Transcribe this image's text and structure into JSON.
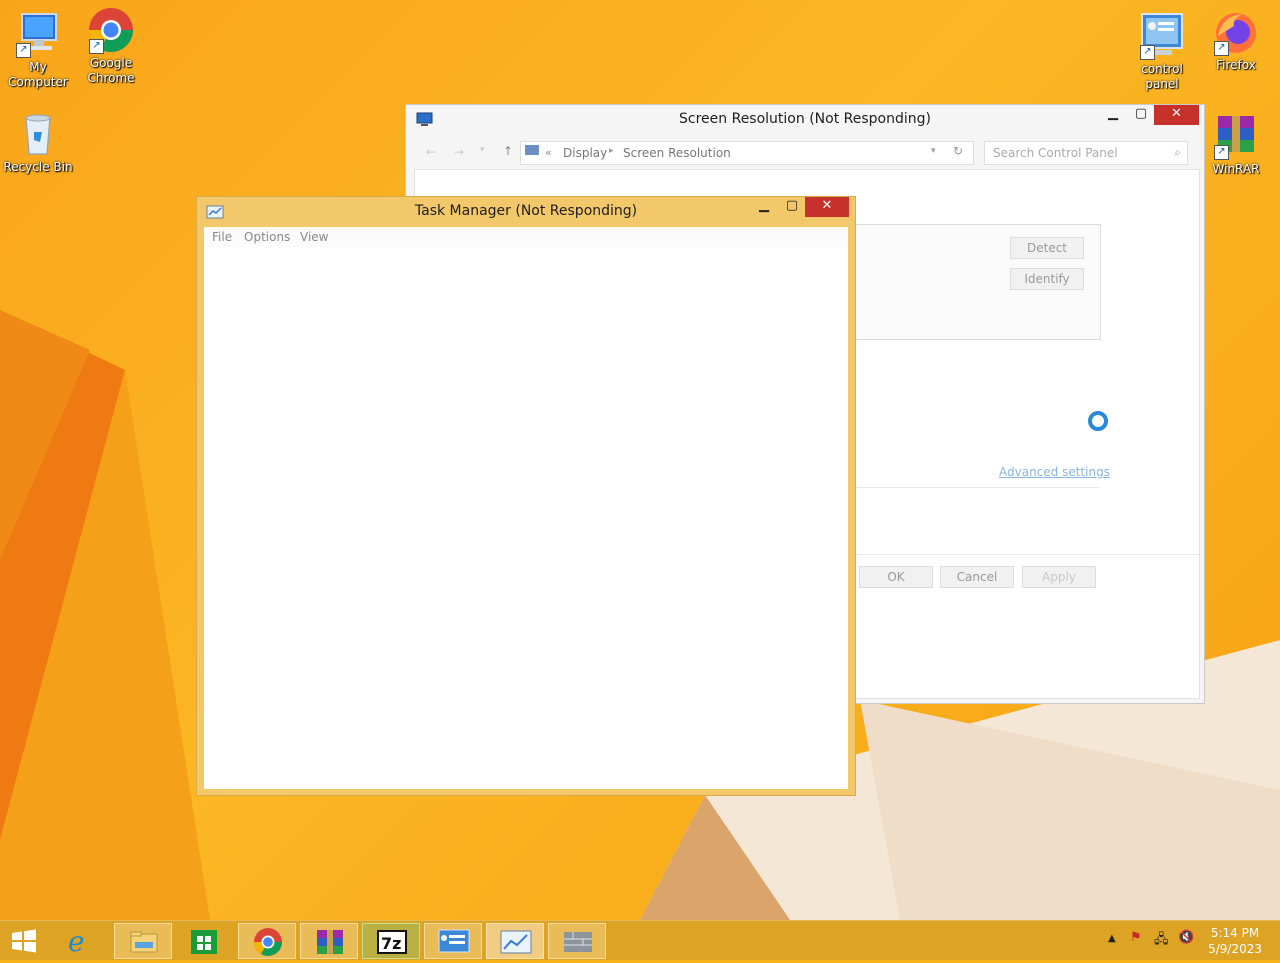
{
  "desktop_icons": {
    "my_computer": "My Computer",
    "chrome": "Google Chrome",
    "recycle_bin": "Recycle Bin",
    "control_panel": "control panel",
    "firefox": "Firefox",
    "winrar": "WinRAR"
  },
  "screen_res_window": {
    "title": "Screen Resolution (Not Responding)",
    "breadcrumb_sep": "«",
    "breadcrumb": [
      "Display",
      "Screen Resolution"
    ],
    "search_placeholder": "Search Control Panel",
    "detect": "Detect",
    "identify": "Identify",
    "advanced_settings": "Advanced settings",
    "ok": "OK",
    "cancel": "Cancel",
    "apply": "Apply"
  },
  "task_manager": {
    "title": "Task Manager (Not Responding)",
    "menu": [
      "File",
      "Options",
      "View"
    ]
  },
  "taskbar": {
    "time": "5:14 PM",
    "date": "5/9/2023",
    "apps": [
      "start",
      "internet-explorer",
      "file-explorer",
      "store",
      "chrome",
      "winrar",
      "7zip",
      "control-panel",
      "task-manager",
      "firewall"
    ]
  },
  "colors": {
    "accent": "#c7312b",
    "taskmgr_frame": "#f2c86a",
    "desktop": "#f9a51a"
  }
}
